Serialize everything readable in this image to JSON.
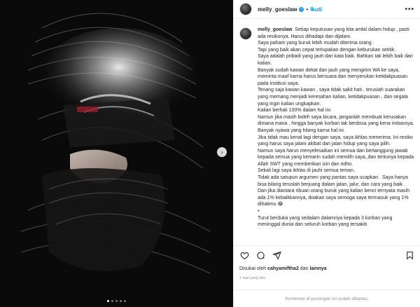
{
  "post": {
    "username": "melly_goeslaw",
    "follow_label": "Ikuti",
    "separator": "•",
    "more_label": "•••",
    "caption": "Setiap keputusan yang kita ambil dalam hidup , pasti ada resikonya. Harus dihadapi dan dijalani.\nSaya paham yang buruk lebih mudah diterima orang .\nTapi yang baik akan cepat terlupakan dengan keburukan setitik.\nSaya adalah pribadi yang jauh dari kata baik. Bahkan tak lebih baik dari kalian.\nBanyak sudah kawan dekat dan jauh yang mengirim WA ke saya, meminta maaf karna harus bersuara dan menyerukan ketidakpuasan pada institusi saya.\nTenang saja kawan kawan , saya tidak sakit hati , teruslah suarakan yang memang menjadi keresahan kalian, ketidakpuasan , dan segala yang ingin kalian ungkapkan.\nKalian berhak 100% dalam hal ini.\nNamun jika masih boleh saya bicara, janganlah membuat kerusakan dimana mana , hingga banyak korban tak berdosa yang kena imbasnya.\nBanyak nyawa yang hilang karna hal ini.\nJika tidak mau kenal lagi dengan saya, saya ikhlas menerima. Ini resiko yang harus saya jalani akibat dari jalan hidup yang saya pilih.\nNamun saya harus menyelesaikan ini semua dan bertanggung jawab kepada semua yang kemarin sudah memilih saya,,dan tentunya kepada Allah SWT yang memberikan izin dan ridho.\nSekali lagi saya ikhlas di jauhi semua teman.\nTidak ada satupun argumen yang pantas saya ucapkan . Saya hanya bisa bilang teruslah berjuang dalam jalan, jalur, dan cara yang baik .\nDan jika diantara ribuan orang buruk yang kalian benci ternyata masih ada 1% kebaikkannya, doakan saya semoga saya termasuk yang 1% dihatimu 😂\n•\nTurut berduka yang sedalam dalamnya kepada 3 korban yang meninggal dunia dan seluruh korban yang tersakiti"
  },
  "engagement": {
    "liked_prefix": "Disukai oleh",
    "liked_user": "cahyamiftha2",
    "liked_joiner": "dan",
    "liked_others": "lainnya",
    "timestamp": "1 hari yang lalu"
  },
  "comments": {
    "disabled_text": "Komentar di postingan ini sudah dibatasi."
  },
  "media": {
    "next_label": "›",
    "slide_count": 5,
    "active_slide": 1
  },
  "icons": {
    "like": "heart-icon",
    "comment": "comment-icon",
    "share": "share-icon",
    "save": "bookmark-icon",
    "verified": "verified-badge-icon"
  },
  "colors": {
    "link_blue": "#0095f6",
    "verified_blue": "#1d9bf0",
    "muted": "#8e8e8e"
  }
}
